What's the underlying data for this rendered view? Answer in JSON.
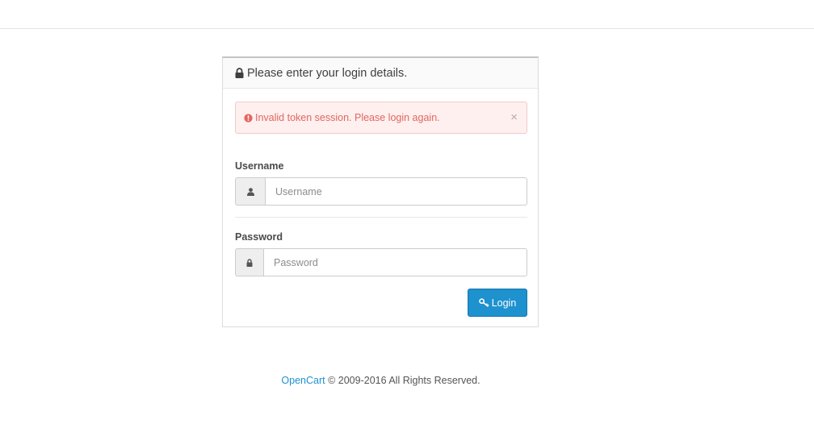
{
  "panel": {
    "heading": "Please enter your login details."
  },
  "alert": {
    "message": "Invalid token session. Please login again.",
    "close": "×"
  },
  "form": {
    "username_label": "Username",
    "username_placeholder": "Username",
    "password_label": "Password",
    "password_placeholder": "Password",
    "login_label": "Login"
  },
  "footer": {
    "link_text": "OpenCart",
    "rest_text": " © 2009-2016 All Rights Reserved."
  },
  "icons": {
    "heading": "lock-icon",
    "alert": "exclamation-circle-icon",
    "username": "user-icon",
    "password": "lock-icon",
    "login": "key-icon"
  },
  "colors": {
    "accent": "#1e91cf",
    "alert_text": "#e36661",
    "alert_bg": "#fdf0ef"
  }
}
